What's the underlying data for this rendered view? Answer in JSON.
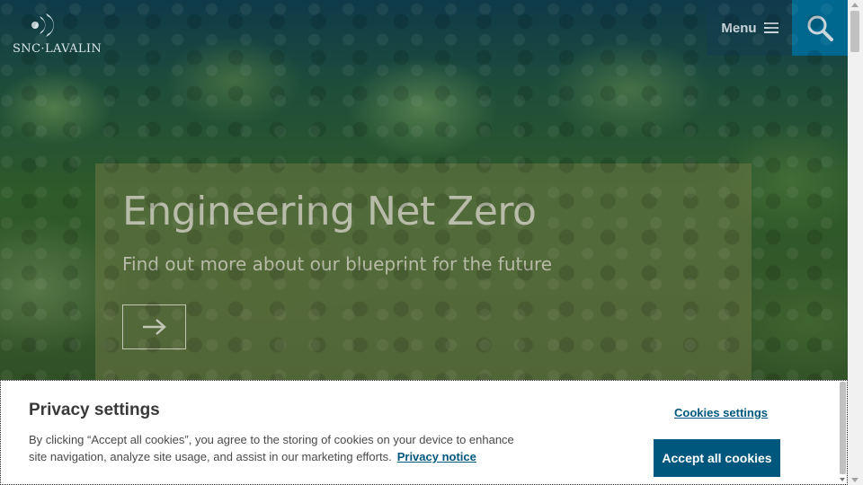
{
  "header": {
    "logo_text": "SNC·LAVALIN",
    "menu_label": "Menu",
    "search_icon": "search-icon",
    "menu_icon": "hamburger-icon"
  },
  "hero": {
    "title": "Engineering Net Zero",
    "subtitle": "Find out more about our blueprint for the future",
    "arrow_icon": "arrow-right-icon"
  },
  "cookie_banner": {
    "title": "Privacy settings",
    "body": "By clicking “Accept all cookies”, you agree to the storing of cookies on your device to enhance site navigation, analyze site usage, and assist in our marketing efforts.",
    "privacy_link": "Privacy notice",
    "settings_link": "Cookies settings",
    "accept_label": "Accept all cookies"
  },
  "colors": {
    "accent": "#00577d",
    "search_bg": "#00688f"
  }
}
